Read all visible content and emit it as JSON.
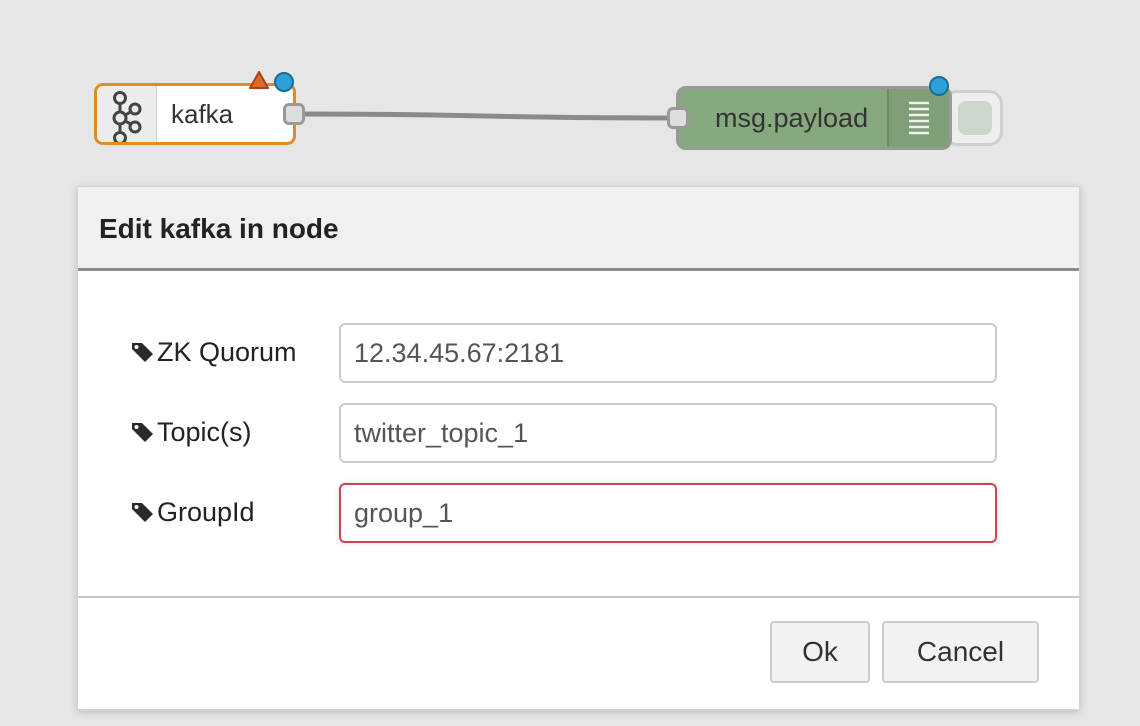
{
  "canvas": {
    "nodes": [
      {
        "label": "kafka",
        "icon": "kafka-icon",
        "status": "warning-triangle",
        "changed": true
      },
      {
        "label": "msg.payload",
        "icon": "debug-list-icon",
        "changed": true
      }
    ]
  },
  "dialog": {
    "title": "Edit kafka in node",
    "fields": [
      {
        "label": "ZK Quorum",
        "value": "12.34.45.67:2181",
        "icon": "tag-icon"
      },
      {
        "label": "Topic(s)",
        "value": "twitter_topic_1",
        "icon": "tag-icon"
      },
      {
        "label": "GroupId",
        "value": "group_1",
        "icon": "tag-icon",
        "state": "invalid"
      }
    ],
    "buttons": {
      "ok": "Ok",
      "cancel": "Cancel"
    }
  },
  "colors": {
    "canvas_bg": "#e6e6e6",
    "kafka_border": "#e08a2a",
    "debug_node_fill": "#87a980",
    "changed_dot": "#2ea0d8",
    "warning_triangle": "#e06a2a",
    "invalid_border": "#c8484f"
  }
}
